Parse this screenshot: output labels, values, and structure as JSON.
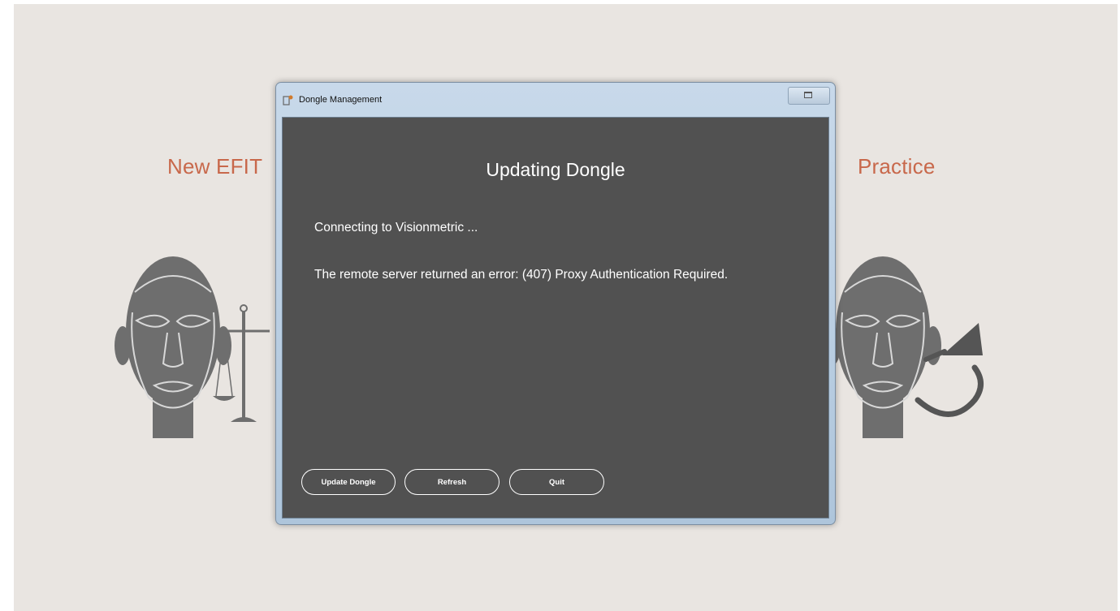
{
  "background": {
    "left_label": "New EFIT",
    "right_label": "Practice",
    "accent_color": "#c8684b",
    "icons": [
      "face-icon",
      "scales-icon",
      "face-icon",
      "rotate-arrow-icon"
    ]
  },
  "window": {
    "title": "Dongle Management",
    "icon": "app-icon",
    "heading": "Updating Dongle",
    "messages": [
      "Connecting to Visionmetric ...",
      "The remote server returned an error: (407) Proxy Authentication Required."
    ],
    "buttons": {
      "update": "Update Dongle",
      "refresh": "Refresh",
      "quit": "Quit"
    },
    "client_color": "#515151"
  }
}
